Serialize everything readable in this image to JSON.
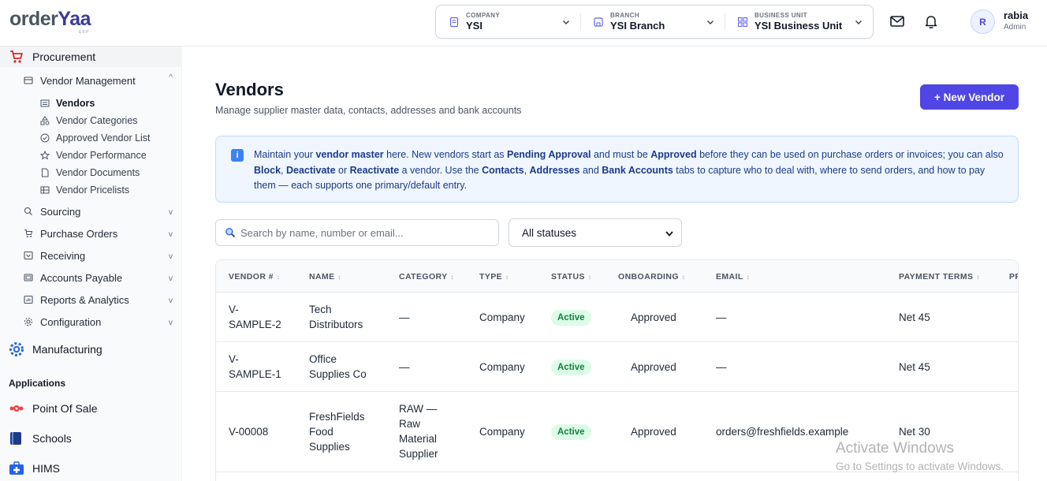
{
  "header": {
    "logo_main": "order",
    "logo_accent": "Yaa",
    "logo_sub": "ERP",
    "company": {
      "label": "COMPANY",
      "value": "YSI"
    },
    "branch": {
      "label": "BRANCH",
      "value": "YSI Branch"
    },
    "business_unit": {
      "label": "BUSINESS UNIT",
      "value": "YSI Business Unit"
    },
    "user": {
      "initial": "R",
      "name": "rabia",
      "role": "Admin"
    }
  },
  "sidebar": {
    "procurement": "Procurement",
    "vendor_management": "Vendor Management",
    "vendor_leaves": [
      "Vendors",
      "Vendor Categories",
      "Approved Vendor List",
      "Vendor Performance",
      "Vendor Documents",
      "Vendor Pricelists"
    ],
    "sub_modules": [
      "Sourcing",
      "Purchase Orders",
      "Receiving",
      "Accounts Payable",
      "Reports & Analytics",
      "Configuration"
    ],
    "manufacturing": "Manufacturing",
    "applications_title": "Applications",
    "apps": [
      "Point Of Sale",
      "Schools",
      "HIMS"
    ]
  },
  "page": {
    "title": "Vendors",
    "subtitle": "Manage supplier master data, contacts, addresses and bank accounts",
    "new_button": "+ New Vendor"
  },
  "info": {
    "parts": [
      "Maintain your ",
      "vendor master",
      " here. New vendors start as ",
      "Pending Approval",
      " and must be ",
      "Approved",
      " before they can be used on purchase orders or invoices; you can also ",
      "Block",
      ", ",
      "Deactivate",
      " or ",
      "Reactivate",
      " a vendor. Use the ",
      "Contacts",
      ", ",
      "Addresses",
      " and ",
      "Bank Accounts",
      " tabs to capture who to deal with, where to send orders, and how to pay them — each supports one primary/default entry."
    ]
  },
  "filters": {
    "search_placeholder": "Search by name, number or email...",
    "status_value": "All statuses"
  },
  "table": {
    "columns": [
      "VENDOR #",
      "NAME",
      "CATEGORY",
      "TYPE",
      "STATUS",
      "ONBOARDING",
      "EMAIL",
      "PAYMENT TERMS",
      "PR"
    ],
    "rows": [
      {
        "number": "V-\nSAMPLE-2",
        "name": "Tech\nDistributors",
        "category": "—",
        "type": "Company",
        "status": "Active",
        "onboarding": "Approved",
        "email": "—",
        "terms": "Net 45"
      },
      {
        "number": "V-\nSAMPLE-1",
        "name": "Office\nSupplies Co",
        "category": "—",
        "type": "Company",
        "status": "Active",
        "onboarding": "Approved",
        "email": "—",
        "terms": "Net 45"
      },
      {
        "number": "V-00008",
        "name": "FreshFields\nFood\nSupplies",
        "category": "RAW —\nRaw\nMaterial\nSupplier",
        "type": "Company",
        "status": "Active",
        "onboarding": "Approved",
        "email": "orders@freshfields.example",
        "terms": "Net 30"
      }
    ]
  },
  "watermark": {
    "line1": "Activate Windows",
    "line2": "Go to Settings to activate Windows."
  }
}
